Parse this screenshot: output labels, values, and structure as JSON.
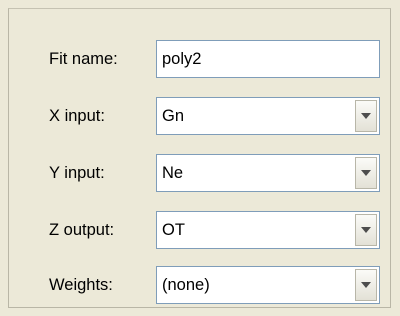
{
  "form": {
    "fit_name": {
      "label": "Fit name:",
      "value": "poly2"
    },
    "x_input": {
      "label": "X input:",
      "value": "Gn",
      "icon": "chevron-down-icon"
    },
    "y_input": {
      "label": "Y input:",
      "value": "Ne",
      "icon": "chevron-down-icon"
    },
    "z_output": {
      "label": "Z output:",
      "value": "OT",
      "icon": "chevron-down-icon"
    },
    "weights": {
      "label": "Weights:",
      "value": "(none)",
      "icon": "chevron-down-icon"
    }
  },
  "colors": {
    "panel_bg": "#ece9d8",
    "field_border": "#7f9db9",
    "field_bg": "#ffffff"
  }
}
